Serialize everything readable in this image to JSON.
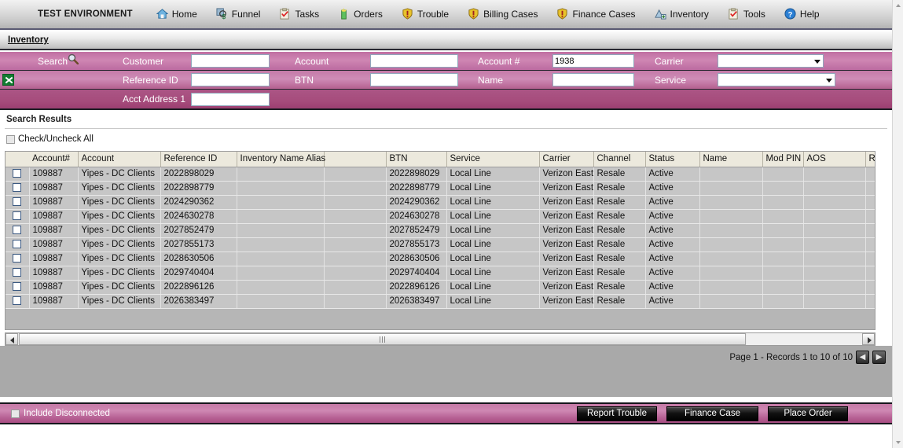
{
  "nav": {
    "env_label": "TEST ENVIRONMENT",
    "items": [
      {
        "label": "Home",
        "icon": "home-icon"
      },
      {
        "label": "Funnel",
        "icon": "funnel-icon"
      },
      {
        "label": "Tasks",
        "icon": "tasks-clipboard-icon"
      },
      {
        "label": "Orders",
        "icon": "orders-icon"
      },
      {
        "label": "Trouble",
        "icon": "trouble-shield-icon"
      },
      {
        "label": "Billing Cases",
        "icon": "billing-shield-icon"
      },
      {
        "label": "Finance Cases",
        "icon": "finance-shield-icon"
      },
      {
        "label": "Inventory",
        "icon": "inventory-icon"
      },
      {
        "label": "Tools",
        "icon": "tools-clipboard-icon"
      },
      {
        "label": "Help",
        "icon": "help-question-icon"
      }
    ]
  },
  "tab": {
    "title": "Inventory"
  },
  "search": {
    "label": "Search",
    "search_icon": "magnifier-icon",
    "excel_icon": "excel-export-icon",
    "fields": {
      "customer": {
        "label": "Customer",
        "value": ""
      },
      "account": {
        "label": "Account",
        "value": ""
      },
      "account_num": {
        "label": "Account #",
        "value": "1938"
      },
      "carrier": {
        "label": "Carrier",
        "value": ""
      },
      "reference_id": {
        "label": "Reference ID",
        "value": ""
      },
      "btn": {
        "label": "BTN",
        "value": ""
      },
      "name": {
        "label": "Name",
        "value": ""
      },
      "service": {
        "label": "Service",
        "value": ""
      },
      "acct_address": {
        "label": "Acct Address 1",
        "value": ""
      }
    }
  },
  "results": {
    "title": "Search Results",
    "check_all_label": "Check/Uncheck All",
    "columns": [
      "",
      "Account#",
      "Account",
      "Reference ID",
      "Inventory Name Alias",
      "",
      "BTN",
      "Service",
      "Carrier",
      "Channel",
      "Status",
      "Name",
      "Mod PIN",
      "AOS",
      "RTN"
    ],
    "rows": [
      {
        "account_num": "109887",
        "account": "Yipes - DC Clients",
        "reference_id": "2022898029",
        "alias": "",
        "blank": "",
        "btn": "2022898029",
        "service": "Local Line",
        "carrier": "Verizon East",
        "channel": "Resale",
        "status": "Active",
        "name": "",
        "mod_pin": "",
        "aos": "",
        "rtn": ""
      },
      {
        "account_num": "109887",
        "account": "Yipes - DC Clients",
        "reference_id": "2022898779",
        "alias": "",
        "blank": "",
        "btn": "2022898779",
        "service": "Local Line",
        "carrier": "Verizon East",
        "channel": "Resale",
        "status": "Active",
        "name": "",
        "mod_pin": "",
        "aos": "",
        "rtn": ""
      },
      {
        "account_num": "109887",
        "account": "Yipes - DC Clients",
        "reference_id": "2024290362",
        "alias": "",
        "blank": "",
        "btn": "2024290362",
        "service": "Local Line",
        "carrier": "Verizon East",
        "channel": "Resale",
        "status": "Active",
        "name": "",
        "mod_pin": "",
        "aos": "",
        "rtn": ""
      },
      {
        "account_num": "109887",
        "account": "Yipes - DC Clients",
        "reference_id": "2024630278",
        "alias": "",
        "blank": "",
        "btn": "2024630278",
        "service": "Local Line",
        "carrier": "Verizon East",
        "channel": "Resale",
        "status": "Active",
        "name": "",
        "mod_pin": "",
        "aos": "",
        "rtn": ""
      },
      {
        "account_num": "109887",
        "account": "Yipes - DC Clients",
        "reference_id": "2027852479",
        "alias": "",
        "blank": "",
        "btn": "2027852479",
        "service": "Local Line",
        "carrier": "Verizon East",
        "channel": "Resale",
        "status": "Active",
        "name": "",
        "mod_pin": "",
        "aos": "",
        "rtn": ""
      },
      {
        "account_num": "109887",
        "account": "Yipes - DC Clients",
        "reference_id": "2027855173",
        "alias": "",
        "blank": "",
        "btn": "2027855173",
        "service": "Local Line",
        "carrier": "Verizon East",
        "channel": "Resale",
        "status": "Active",
        "name": "",
        "mod_pin": "",
        "aos": "",
        "rtn": ""
      },
      {
        "account_num": "109887",
        "account": "Yipes - DC Clients",
        "reference_id": "2028630506",
        "alias": "",
        "blank": "",
        "btn": "2028630506",
        "service": "Local Line",
        "carrier": "Verizon East",
        "channel": "Resale",
        "status": "Active",
        "name": "",
        "mod_pin": "",
        "aos": "",
        "rtn": ""
      },
      {
        "account_num": "109887",
        "account": "Yipes - DC Clients",
        "reference_id": "2029740404",
        "alias": "",
        "blank": "",
        "btn": "2029740404",
        "service": "Local Line",
        "carrier": "Verizon East",
        "channel": "Resale",
        "status": "Active",
        "name": "",
        "mod_pin": "",
        "aos": "",
        "rtn": ""
      },
      {
        "account_num": "109887",
        "account": "Yipes - DC Clients",
        "reference_id": "2022896126",
        "alias": "",
        "blank": "",
        "btn": "2022896126",
        "service": "Local Line",
        "carrier": "Verizon East",
        "channel": "Resale",
        "status": "Active",
        "name": "",
        "mod_pin": "",
        "aos": "",
        "rtn": ""
      },
      {
        "account_num": "109887",
        "account": "Yipes - DC Clients",
        "reference_id": "2026383497",
        "alias": "",
        "blank": "",
        "btn": "2026383497",
        "service": "Local Line",
        "carrier": "Verizon East",
        "channel": "Resale",
        "status": "Active",
        "name": "",
        "mod_pin": "",
        "aos": "",
        "rtn": ""
      }
    ]
  },
  "pager": {
    "text": "Page 1 - Records 1 to 10 of 10",
    "prev_label": "◀",
    "next_label": "▶"
  },
  "footer": {
    "include_disconnected_label": "Include Disconnected",
    "report_trouble_label": "Report Trouble",
    "finance_case_label": "Finance Case",
    "place_order_label": "Place Order"
  },
  "colors": {
    "panel_pink": "#c47aa8",
    "panel_pink_dark": "#a64c7c",
    "header_beige": "#ece9dd",
    "row_gray": "#c6c6c6",
    "button_black": "#000000"
  }
}
